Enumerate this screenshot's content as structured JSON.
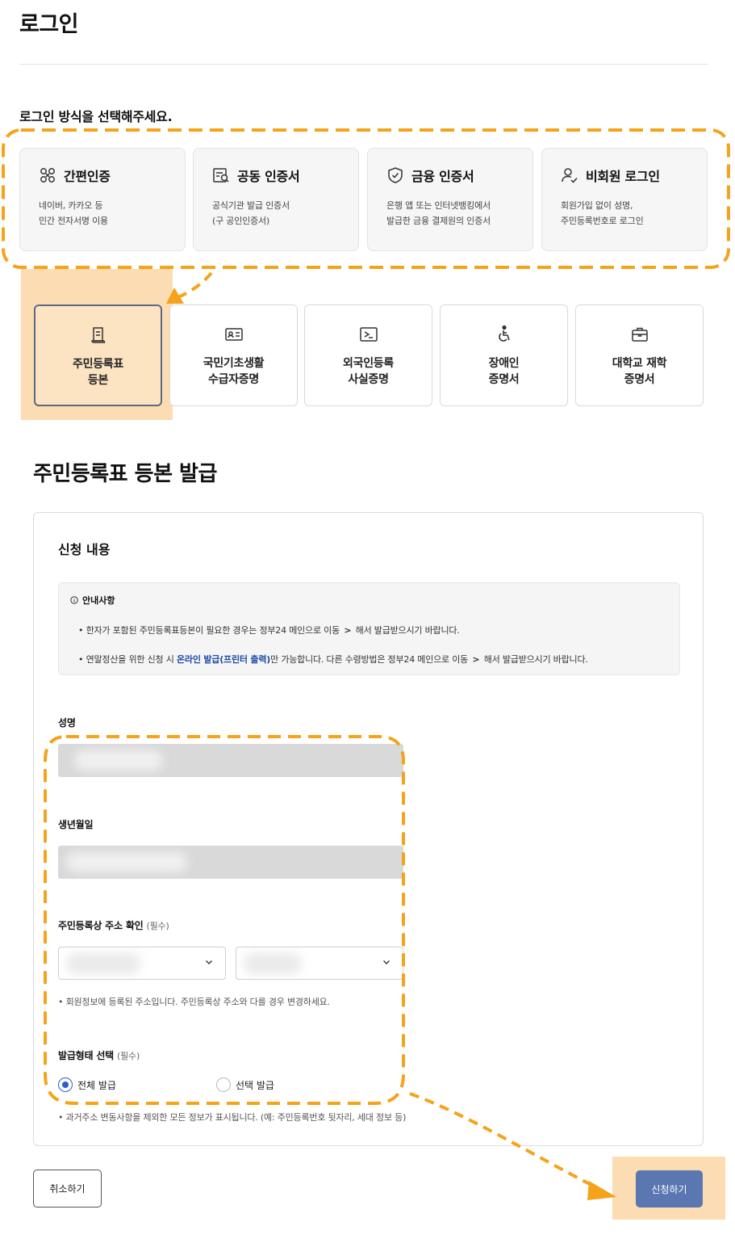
{
  "page_title": "로그인",
  "login_section_label": "로그인 방식을 선택해주세요.",
  "login_methods": [
    {
      "icon": "simple-auth-icon",
      "title": "간편인증",
      "desc": "네이버, 카카오 등\n민간 전자서명 이용"
    },
    {
      "icon": "certificate-icon",
      "title": "공동 인증서",
      "desc": "공식기관 발급 인증서\n(구 공인인증서)"
    },
    {
      "icon": "shield-check-icon",
      "title": "금융 인증서",
      "desc": "은행 앱 또는 인터넷뱅킹에서\n발급한 금융 결제원의 인증서"
    },
    {
      "icon": "user-check-icon",
      "title": "비회원 로그인",
      "desc": "회원가입 없이 성명,\n주민등록번호로 로그인"
    }
  ],
  "certificates": [
    {
      "icon": "document-scroll-icon",
      "label": "주민등록표\n등본",
      "selected": true
    },
    {
      "icon": "id-card-icon",
      "label": "국민기초생활\n수급자증명",
      "selected": false
    },
    {
      "icon": "passport-plane-icon",
      "label": "외국인등록\n사실증명",
      "selected": false
    },
    {
      "icon": "wheelchair-icon",
      "label": "장애인\n증명서",
      "selected": false
    },
    {
      "icon": "briefcase-icon",
      "label": "대학교 재학\n증명서",
      "selected": false
    }
  ],
  "issue_title": "주민등록표 등본 발급",
  "form": {
    "panel_title": "신청 내용",
    "notice": {
      "title": "안내사항",
      "line1": {
        "prefix": "• 한자가 포함된 주민등록표등본이 필요한 경우는 정부24 메인으로 이동",
        "chev": ">",
        "suffix": "해서 발급받으시기 바랍니다."
      },
      "line2": {
        "prefix": "• 연말정산을 위한 신청 시",
        "strong": "온라인 발급(프린터 출력)",
        "middle": "만 가능합니다. 다른 수령방법은  정부24 메인으로 이동",
        "chev": ">",
        "suffix": "해서 발급받으시기 바랍니다."
      }
    },
    "name_label": "성명",
    "birth_label": "생년월일",
    "address_label": "주민등록상 주소 확인",
    "address_required": "(필수)",
    "address_hint": "• 회원정보에 등록된 주소입니다. 주민등록상 주소와 다를 경우 변경하세요.",
    "issue_type_label": "발급형태 선택",
    "issue_type_required": "(필수)",
    "issue_options": [
      {
        "label": "전체 발급",
        "checked": true
      },
      {
        "label": "선택 발급",
        "checked": false
      }
    ],
    "issue_hint": "• 과거주소 변동사항을 제외한 모든 정보가 표시됩니다. (예: 주민등록번호 뒷자리, 세대 정보 등)"
  },
  "buttons": {
    "cancel": "취소하기",
    "submit": "신청하기"
  },
  "colors": {
    "highlight": "#fcdcb2",
    "annotation": "#f5a31a",
    "submit": "#5a77b2",
    "link": "#1f4aa6"
  }
}
